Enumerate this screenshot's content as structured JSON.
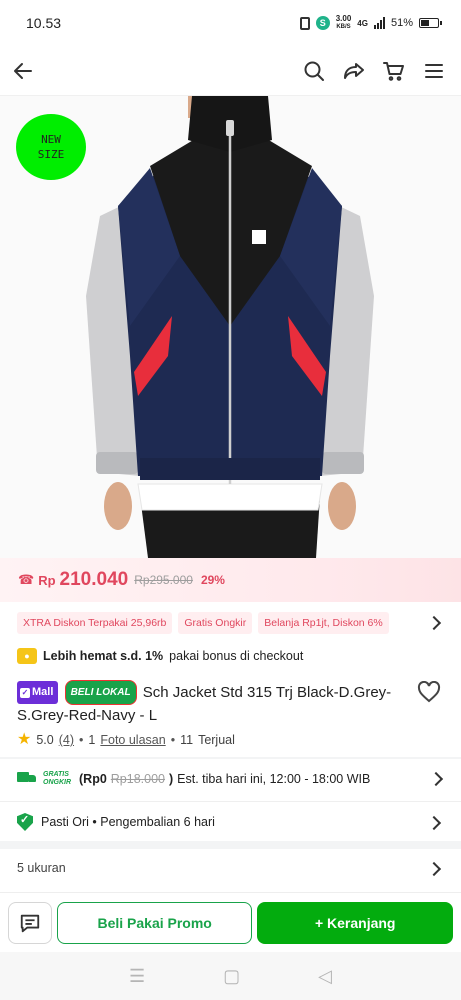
{
  "status_bar": {
    "time": "10.53",
    "speed_value": "3.00",
    "speed_unit": "KB/S",
    "network": "4G",
    "battery": "51%"
  },
  "nav": {
    "back_icon": "back-arrow-icon",
    "search_icon": "search-icon",
    "share_icon": "share-icon",
    "cart_icon": "cart-icon",
    "menu_icon": "menu-icon"
  },
  "product": {
    "badge_line1": "NEW",
    "badge_line2": "SIZE",
    "price_currency": "Rp",
    "price": "210.040",
    "price_original": "Rp295.000",
    "discount": "29%",
    "promos": [
      "XTRA Diskon Terpakai 25,96rb",
      "Gratis Ongkir",
      "Belanja Rp1jt, Diskon 6%"
    ],
    "hemat_bold": "Lebih hemat s.d. 1%",
    "hemat_rest": "pakai bonus di checkout",
    "mall_label": "Mall",
    "beli_label": "BELI LOKAL",
    "title": "Sch Jacket Std 315 Trj Black-D.Grey-S.Grey-Red-Navy - L",
    "rating": "5.0",
    "rating_count": "(4)",
    "photo_reviews_count": "1",
    "photo_reviews_label": "Foto ulasan",
    "sold_count": "11",
    "sold_label": "Terjual"
  },
  "shipping": {
    "gratis_line1": "GRATIS",
    "gratis_line2": "ONGKIR",
    "price_open": "(Rp0",
    "price_struck": "Rp18.000",
    "price_close": ")",
    "estimate": "Est. tiba hari ini, 12:00 - 18:00 WIB"
  },
  "guarantee": {
    "text": "Pasti Ori • Pengembalian 6 hari"
  },
  "sizes": {
    "label": "5 ukuran"
  },
  "actions": {
    "promo_label": "Beli Pakai Promo",
    "cart_label": "+ Keranjang"
  },
  "colors": {
    "accent_green": "#03ac0e",
    "price_red": "#e0475e",
    "badge_green": "#00ee00",
    "mall_purple": "#6c2ed8",
    "jacket_navy": "#1e2a52"
  }
}
